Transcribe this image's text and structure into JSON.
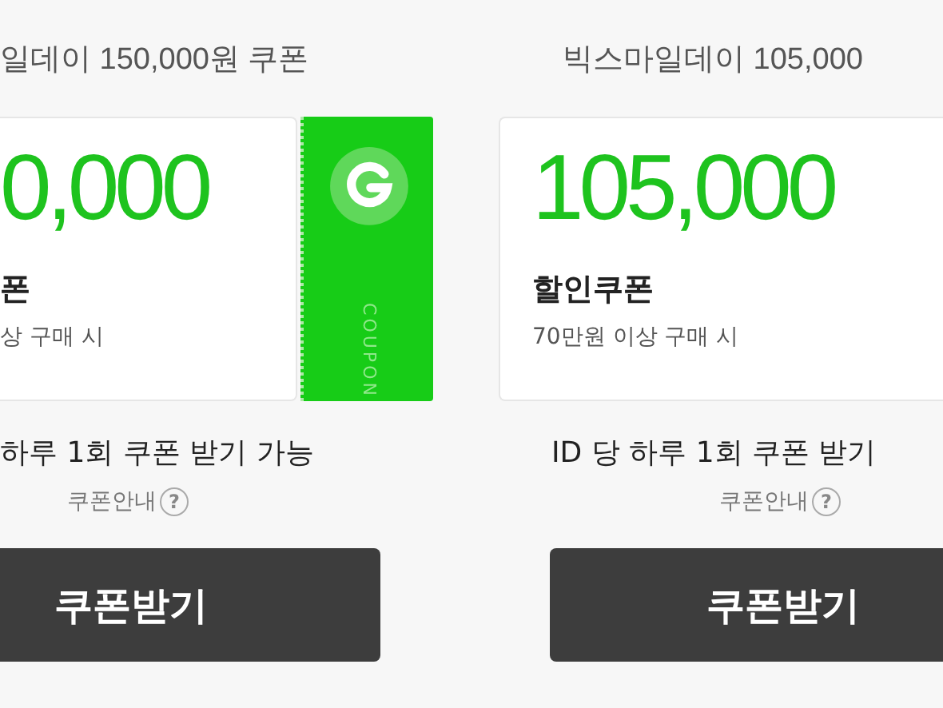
{
  "coupons": [
    {
      "title": "일데이 150,000원 쿠폰",
      "amount": "0,000",
      "type": "폰",
      "condition": "상 구매 시",
      "stub": {
        "label": "COUPON"
      },
      "limit": "하루 1회 쿠폰 받기 가능",
      "guide": "쿠폰안내",
      "help": "?",
      "button": "쿠폰받기"
    },
    {
      "title": "빅스마일데이 105,000",
      "amount": "105,000",
      "type": "할인쿠폰",
      "condition": "70만원 이상 구매 시",
      "limit": "ID 당 하루 1회 쿠폰 받기",
      "guide": "쿠폰안내",
      "help": "?",
      "button": "쿠폰받기"
    }
  ]
}
